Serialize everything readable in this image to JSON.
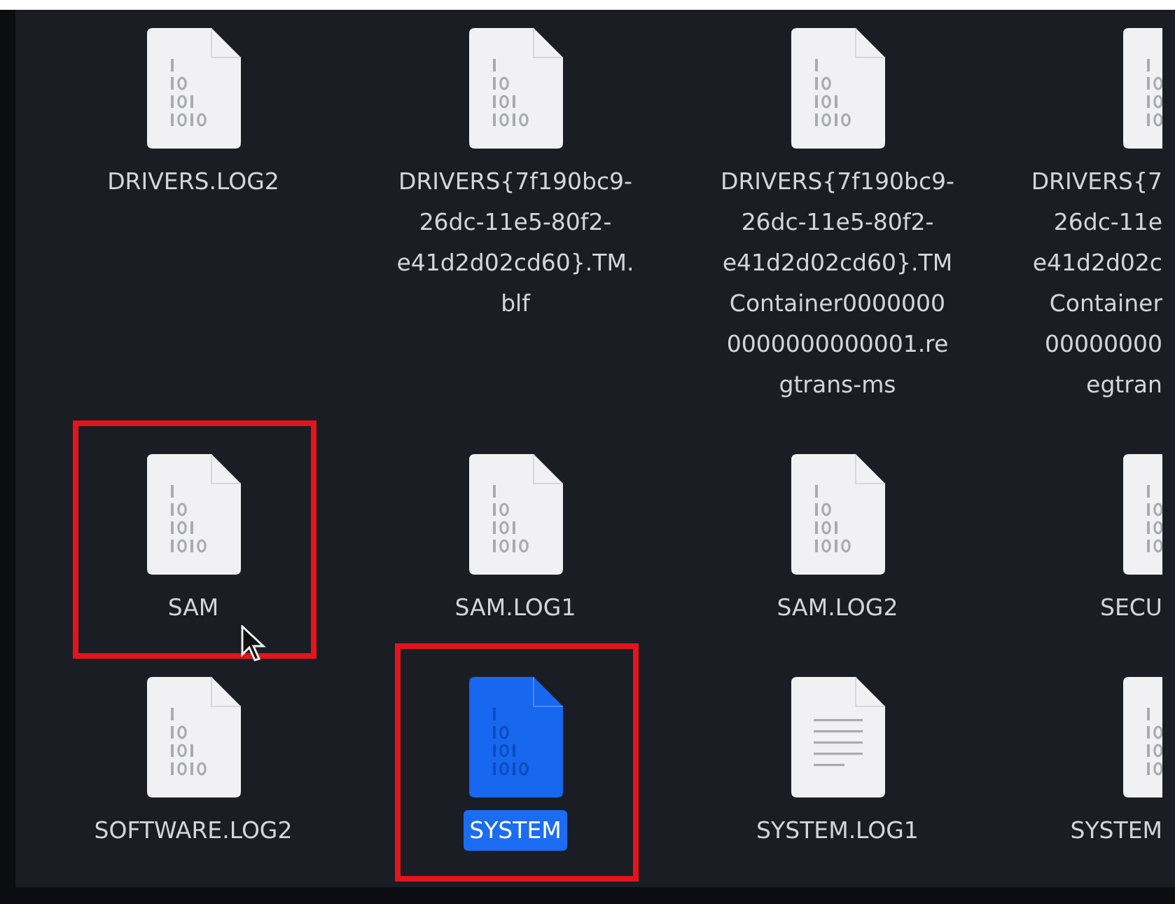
{
  "files": [
    {
      "kind": "binary",
      "lines": [
        "DRIVERS.LOG2"
      ],
      "selected": false,
      "marked": false,
      "clipped": false
    },
    {
      "kind": "binary",
      "lines": [
        "DRIVERS{7f190bc9-",
        "26dc-11e5-80f2-",
        "e41d2d02cd60}.TM.",
        "blf"
      ],
      "selected": false,
      "marked": false,
      "clipped": false
    },
    {
      "kind": "binary",
      "lines": [
        "DRIVERS{7f190bc9-",
        "26dc-11e5-80f2-",
        "e41d2d02cd60}.TM",
        "Container0000000",
        "0000000000001.re",
        "gtrans-ms"
      ],
      "selected": false,
      "marked": false,
      "clipped": false
    },
    {
      "kind": "binary",
      "lines": [
        "DRIVERS{7",
        "26dc-11e",
        "e41d2d02c",
        "Container",
        "00000000",
        "egtran"
      ],
      "selected": false,
      "marked": false,
      "clipped": true
    },
    {
      "kind": "binary",
      "lines": [
        "SAM"
      ],
      "selected": false,
      "marked": true,
      "clipped": false
    },
    {
      "kind": "binary",
      "lines": [
        "SAM.LOG1"
      ],
      "selected": false,
      "marked": false,
      "clipped": false
    },
    {
      "kind": "binary",
      "lines": [
        "SAM.LOG2"
      ],
      "selected": false,
      "marked": false,
      "clipped": false
    },
    {
      "kind": "binary",
      "lines": [
        "SECU"
      ],
      "selected": false,
      "marked": false,
      "clipped": true
    },
    {
      "kind": "binary",
      "lines": [
        "SOFTWARE.LOG2"
      ],
      "selected": false,
      "marked": false,
      "clipped": false
    },
    {
      "kind": "binary",
      "lines": [
        "SYSTEM"
      ],
      "selected": true,
      "marked": true,
      "clipped": false
    },
    {
      "kind": "text",
      "lines": [
        "SYSTEM.LOG1"
      ],
      "selected": false,
      "marked": false,
      "clipped": false
    },
    {
      "kind": "binary",
      "lines": [
        "SYSTEM"
      ],
      "selected": false,
      "marked": false,
      "clipped": true
    }
  ]
}
